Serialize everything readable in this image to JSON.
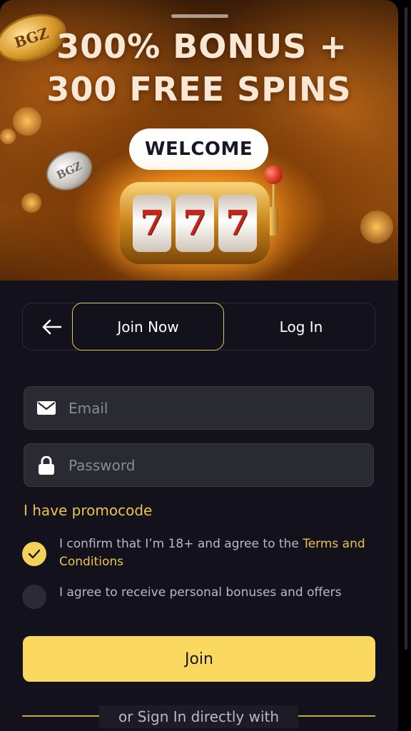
{
  "hero": {
    "headline_line1": "300% BONUS +",
    "headline_line2": "300 FREE SPINS",
    "welcome_label": "WELCOME",
    "coin_gold_text": "BGZ",
    "coin_silver_text": "BGZ",
    "slot_reels": [
      "7",
      "7",
      "7"
    ]
  },
  "tabs": {
    "back_icon": "arrow-left-icon",
    "items": [
      {
        "label": "Join Now",
        "active": true
      },
      {
        "label": "Log In",
        "active": false
      }
    ],
    "active_border_color": "#e6c85a"
  },
  "form": {
    "email": {
      "placeholder": "Email",
      "value": "",
      "icon": "envelope-icon"
    },
    "password": {
      "placeholder": "Password",
      "value": "",
      "icon": "lock-icon"
    },
    "promo_link": "I have promocode",
    "consent_age": {
      "checked": true,
      "text": "I confirm that I’m 18+ and agree to the ",
      "link": "Terms and Conditions"
    },
    "consent_bonuses": {
      "checked": false,
      "text": "I agree to receive personal bonuses and offers"
    },
    "submit_label": "Join"
  },
  "footer": {
    "divider_text": "or Sign In directly with"
  },
  "colors": {
    "background": "#12111c",
    "accent": "#fbd960",
    "link": "#e8c44e",
    "field_bg": "#2a2a33"
  }
}
